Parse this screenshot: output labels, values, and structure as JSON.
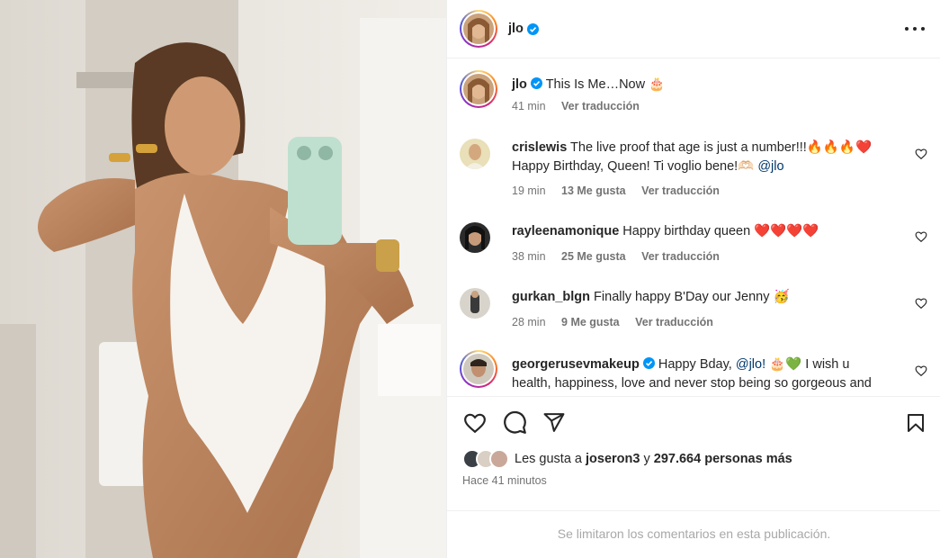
{
  "post": {
    "username": "jlo",
    "verified": true
  },
  "caption": {
    "username": "jlo",
    "text": "This Is Me…Now",
    "emoji": "🎂",
    "time": "41 min",
    "translate": "Ver traducción"
  },
  "comments": [
    {
      "username": "crislewis",
      "text_a": "The live proof that age is just a number!!!",
      "emoji_a": "🔥🔥🔥❤️",
      "text_b": "Happy Birthday, Queen! Ti voglio bene!",
      "emoji_b": "🫶🏻",
      "mention": "@jlo",
      "time": "19 min",
      "likes": "13 Me gusta",
      "translate": "Ver traducción"
    },
    {
      "username": "rayleenamonique",
      "text": "Happy birthday queen",
      "emoji": "❤️❤️❤️❤️",
      "time": "38 min",
      "likes": "25 Me gusta",
      "translate": "Ver traducción"
    },
    {
      "username": "gurkan_blgn",
      "text": "Finally happy B'Day our Jenny",
      "emoji": "🥳",
      "time": "28 min",
      "likes": "9 Me gusta",
      "translate": "Ver traducción"
    },
    {
      "username": "georgerusevmakeup",
      "verified": true,
      "text_a": "Happy Bday,",
      "mention": "@jlo!",
      "emoji": "🎂💚",
      "text_b": "I wish u health, happiness, love and never stop being so gorgeous and"
    }
  ],
  "icons": {
    "like": "heart-icon",
    "comment": "comment-icon",
    "share": "send-icon",
    "save": "bookmark-icon",
    "more": "more-options-icon"
  },
  "likes": {
    "prefix": "Les gusta a",
    "user": "joseron3",
    "connector": "y",
    "count": "297.664 personas más"
  },
  "time_ago": "Hace 41 minutos",
  "comments_limited": "Se limitaron los comentarios en esta publicación.",
  "colors": {
    "verified": "#0095f6",
    "meta_text": "#737373",
    "mention": "#00376b",
    "border": "#efefef"
  }
}
